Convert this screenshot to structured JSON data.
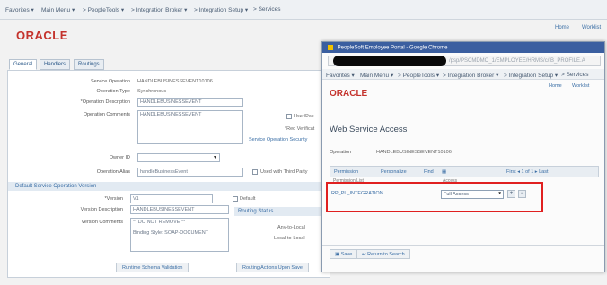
{
  "main": {
    "nav": {
      "favorites": "Favorites ▾",
      "main_menu": "Main Menu ▾",
      "breadcrumb": [
        " > PeopleTools ▾",
        " > Integration Broker ▾",
        " > Integration Setup ▾",
        " > Services"
      ]
    },
    "logo": "ORACLE",
    "header_links": [
      "Home",
      "Worklist"
    ],
    "tabs": [
      "General",
      "Handlers",
      "Routings"
    ],
    "form": {
      "service_operation_label": "Service Operation",
      "service_operation_value": "HANDLEBUSINESSEVENT10106",
      "operation_type_label": "Operation Type",
      "operation_type_value": "Synchronous",
      "operation_description_label": "*Operation Description",
      "operation_description_value": "HANDLEBUSINESSEVENT",
      "operation_comments_label": "Operation Comments",
      "operation_comments_value": "HANDLEBUSINESSEVENT",
      "user_pwd_label": "User/Pas",
      "req_verify_label": "*Req Verificat",
      "service_security_link": "Service Operation Security",
      "owner_id_label": "Owner ID",
      "operation_alias_label": "Operation Alias",
      "operation_alias_value": "handleBusinessEvent",
      "third_party_label": "Used with Third Party"
    },
    "section_title": "Default Service Operation Version",
    "version": {
      "version_label": "*Version",
      "version_value": "V1",
      "default_label": "Default",
      "version_description_label": "Version Description",
      "version_description_value": "HANDLEBUSINESSEVENT",
      "version_comments_label": "Version Comments",
      "version_comments_line1": "** DO NOT REMOVE **",
      "version_comments_line2": "Binding Style: SOAP-DOCUMENT",
      "routing_status_label": "Routing Status",
      "any_to_local_label": "Any-to-Local",
      "local_to_local_label": "Local-to-Local"
    },
    "buttons": {
      "runtime_schema": "Runtime Schema Validation",
      "routing_actions": "Routing Actions Upon Save"
    }
  },
  "popup": {
    "title": "PeopleSoft Employee Portal - Google Chrome",
    "url_tail": "/psp/PSCMDMO_1/EMPLOYEE/HRMS/c/IB_PROFILE.A",
    "nav": {
      "favorites": "Favorites ▾",
      "main_menu": "Main Menu ▾",
      "breadcrumb": [
        " > PeopleTools ▾",
        " > Integration Broker ▾",
        " > Integration Setup ▾",
        " > Services"
      ]
    },
    "logo": "ORACLE",
    "header_links": [
      "Home",
      "Worklist"
    ],
    "heading": "Web Service Access",
    "operation_label": "Operation",
    "operation_value": "HANDLEBUSINESSEVENT10106",
    "grid": {
      "title": "Permission",
      "personalize": "Personalize",
      "find": "Find",
      "paging": "First ◂ 1 of 1 ▸ Last",
      "col1": "Permission List",
      "col2": "Access"
    },
    "row": {
      "permission_list": "RP_PL_INTEGRATION",
      "access": "Full Access"
    },
    "footer": {
      "save": "Save",
      "return_to_search": "Return to Search"
    }
  }
}
